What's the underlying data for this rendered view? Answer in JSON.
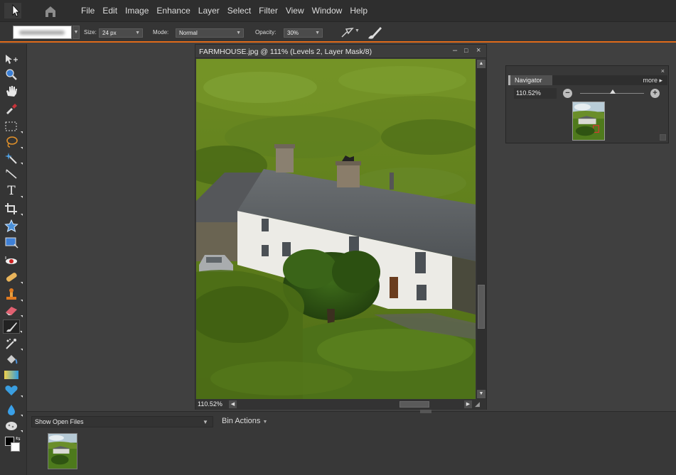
{
  "menubar": {
    "items": [
      "File",
      "Edit",
      "Image",
      "Enhance",
      "Layer",
      "Select",
      "Filter",
      "View",
      "Window",
      "Help"
    ]
  },
  "options": {
    "size_label": "Size:",
    "size_value": "24 px",
    "mode_label": "Mode:",
    "mode_value": "Normal",
    "opacity_label": "Opacity:",
    "opacity_value": "30%",
    "accent_color": "#e06b1a"
  },
  "tools": [
    "move-tool-icon",
    "zoom-tool-icon",
    "hand-tool-icon",
    "eyedropper-tool-icon",
    "marquee-tool-icon",
    "lasso-tool-icon",
    "magic-wand-tool-icon",
    "straighten-tool-icon",
    "type-tool-icon",
    "crop-tool-icon",
    "cookie-cutter-tool-icon",
    "recompose-tool-icon",
    "red-eye-tool-icon",
    "healing-brush-tool-icon",
    "clone-stamp-tool-icon",
    "eraser-tool-icon",
    "brush-tool-icon",
    "smart-brush-tool-icon",
    "paint-bucket-tool-icon",
    "gradient-tool-icon",
    "shape-tool-icon",
    "blur-tool-icon",
    "sponge-tool-icon",
    "color-swatches-icon"
  ],
  "document": {
    "title": "FARMHOUSE.jpg @ 111% (Levels 2, Layer Mask/8)",
    "zoom": "110.52%"
  },
  "navigator": {
    "tab_label": "Navigator",
    "more_label": "more",
    "zoom_value": "110.52%"
  },
  "bin": {
    "show_label": "Show Open Files",
    "actions_label": "Bin Actions"
  }
}
